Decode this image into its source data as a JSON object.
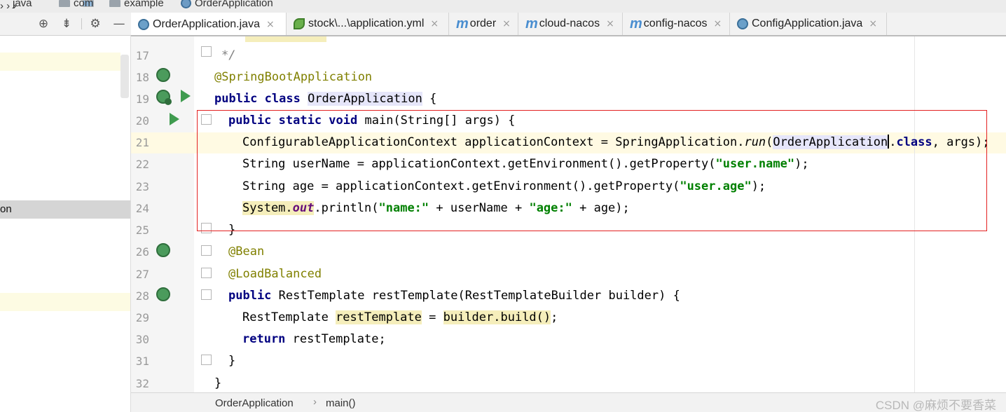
{
  "breadcrumb": {
    "items": [
      "java",
      "com",
      "example",
      "OrderApplication"
    ]
  },
  "left_panel": {
    "selected_item_fragment": "on"
  },
  "tabs": [
    {
      "label": "OrderApplication.java",
      "icon": "spring-class-icon",
      "active": true,
      "close": "×"
    },
    {
      "label": "stock\\...\\application.yml",
      "icon": "spring-leaf-icon",
      "active": false,
      "close": "×"
    },
    {
      "label": "order",
      "icon": "maven-icon",
      "active": false,
      "close": "×"
    },
    {
      "label": "cloud-nacos",
      "icon": "maven-icon",
      "active": false,
      "close": "×"
    },
    {
      "label": "config-nacos",
      "icon": "maven-icon",
      "active": false,
      "close": "×"
    },
    {
      "label": "ConfigApplication.java",
      "icon": "spring-class-icon",
      "active": false,
      "close": "×"
    }
  ],
  "editor": {
    "line_numbers": [
      "17",
      "18",
      "19",
      "20",
      "21",
      "22",
      "23",
      "24",
      "25",
      "26",
      "27",
      "28",
      "29",
      "30",
      "31",
      "32"
    ],
    "lines": {
      "l17": "*/",
      "l18": "@SpringBootApplication",
      "l19_kw": "public class",
      "l19_name": "OrderApplication",
      "l19_end": "{",
      "l20_kw": "public static void",
      "l20_rest": "main(String[] args) {",
      "l21_a": "ConfigurableApplicationContext applicationContext = SpringApplication.",
      "l21_run": "run",
      "l21_b": "(",
      "l21_cls": "OrderApplication",
      "l21_dot": ".",
      "l21_class": "class",
      "l21_end": ", args);",
      "l22_a": "String userName = applicationContext.getEnvironment().getProperty(",
      "l22_str": "\"user.name\"",
      "l22_end": ");",
      "l23_a": "String age = applicationContext.getEnvironment().getProperty(",
      "l23_str": "\"age\"",
      "l23_str_full": "\"user.age\"",
      "l23_end": ");",
      "l24_sys": "System.",
      "l24_out": "out",
      "l24_a": ".println(",
      "l24_s1": "\"name:\"",
      "l24_b": " + userName + ",
      "l24_s2": "\"age:\"",
      "l24_c": " + age);",
      "l25": "}",
      "l26": "@Bean",
      "l27": "@LoadBalanced",
      "l28_kw": "public",
      "l28_rest": "RestTemplate restTemplate(RestTemplateBuilder builder) {",
      "l29_a": "RestTemplate ",
      "l29_var": "restTemplate",
      "l29_b": " = ",
      "l29_call": "builder.build()",
      "l29_end": ";",
      "l30_kw": "return",
      "l30_rest": "restTemplate;",
      "l31": "}",
      "l32": "}"
    }
  },
  "status": {
    "class_crumb": "OrderApplication",
    "chevron": "›",
    "method_crumb": "main()"
  },
  "watermark": "CSDN @麻烦不要香菜",
  "colors": {
    "keyword": "#000080",
    "annotation": "#808000",
    "string": "#008000",
    "highlight": "#e6e6fa",
    "red_box": "#e32121"
  }
}
